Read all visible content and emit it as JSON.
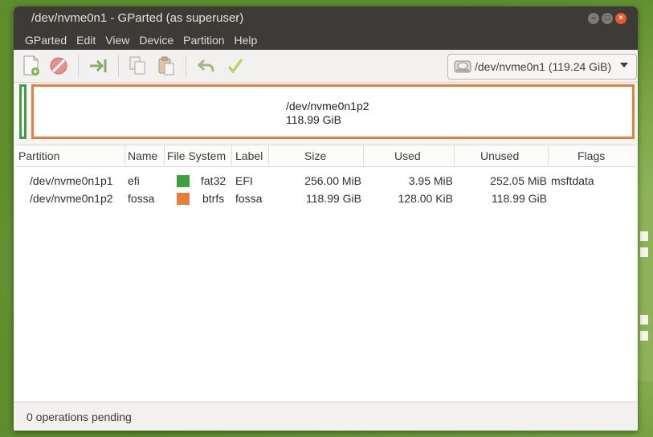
{
  "window": {
    "title": "/dev/nvme0n1 - GParted (as superuser)"
  },
  "menu": [
    "GParted",
    "Edit",
    "View",
    "Device",
    "Partition",
    "Help"
  ],
  "toolbar": {
    "icons": [
      "new-partition-icon",
      "delete-icon",
      "resize-move-icon",
      "copy-icon",
      "paste-icon",
      "undo-icon",
      "apply-icon"
    ],
    "device_selector": "/dev/nvme0n1 (119.24 GiB)"
  },
  "disk_map": {
    "selected_name": "/dev/nvme0n1p2",
    "selected_size": "118.99 GiB",
    "colors": {
      "fat32": "#3fa03f",
      "btrfs": "#e2803e"
    }
  },
  "table": {
    "headers": [
      "Partition",
      "Name",
      "File System",
      "Label",
      "Size",
      "Used",
      "Unused",
      "Flags"
    ],
    "rows": [
      {
        "partition": "/dev/nvme0n1p1",
        "name": "efi",
        "fs": "fat32",
        "fs_color": "#3fa03f",
        "label": "EFI",
        "size": "256.00 MiB",
        "used": "3.95 MiB",
        "unused": "252.05 MiB",
        "flags": "msftdata"
      },
      {
        "partition": "/dev/nvme0n1p2",
        "name": "fossa",
        "fs": "btrfs",
        "fs_color": "#e2803e",
        "label": "fossa",
        "size": "118.99 GiB",
        "used": "128.00 KiB",
        "unused": "118.99 GiB",
        "flags": ""
      }
    ]
  },
  "status": {
    "text": "0 operations pending"
  }
}
